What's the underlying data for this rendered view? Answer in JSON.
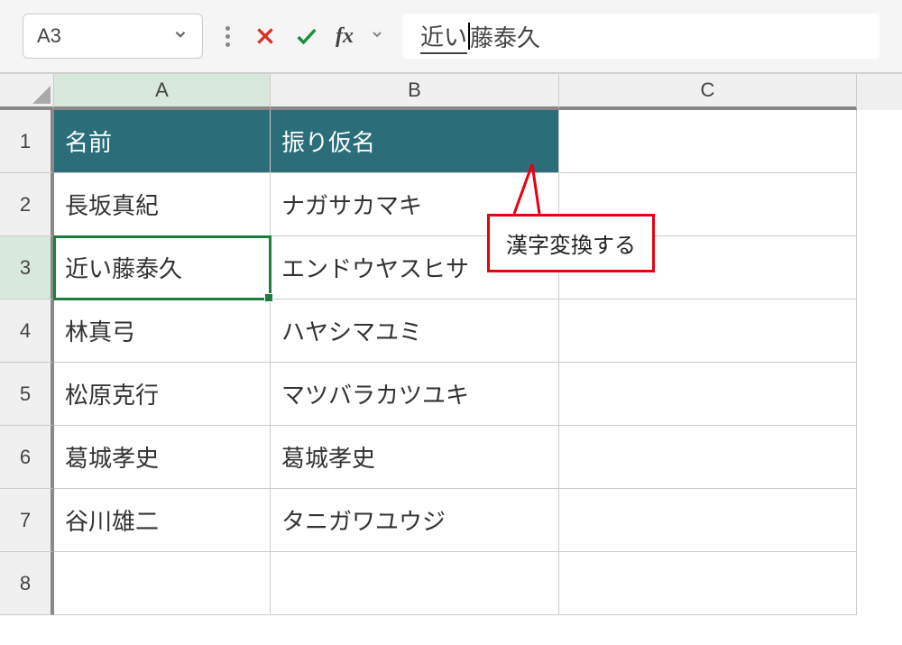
{
  "name_box": {
    "value": "A3"
  },
  "fx_label": "fx",
  "formula_bar": {
    "ime_segment": "近い",
    "rest": "藤泰久"
  },
  "columns": [
    "A",
    "B",
    "C"
  ],
  "rows": [
    {
      "num": "1",
      "a": "名前",
      "b": "振り仮名",
      "c": "",
      "header": true
    },
    {
      "num": "2",
      "a": "長坂真紀",
      "b": "ナガサカマキ",
      "c": ""
    },
    {
      "num": "3",
      "a": "近い藤泰久",
      "b": "エンドウヤスヒサ",
      "c": "",
      "selected": true
    },
    {
      "num": "4",
      "a": "林真弓",
      "b": "ハヤシマユミ",
      "c": ""
    },
    {
      "num": "5",
      "a": "松原克行",
      "b": "マツバラカツユキ",
      "c": ""
    },
    {
      "num": "6",
      "a": "葛城孝史",
      "b": "葛城孝史",
      "c": ""
    },
    {
      "num": "7",
      "a": "谷川雄二",
      "b": "タニガワユウジ",
      "c": ""
    },
    {
      "num": "8",
      "a": "",
      "b": "",
      "c": ""
    }
  ],
  "callout": {
    "text": "漢字変換する"
  },
  "active_column": "A",
  "active_row": "3"
}
